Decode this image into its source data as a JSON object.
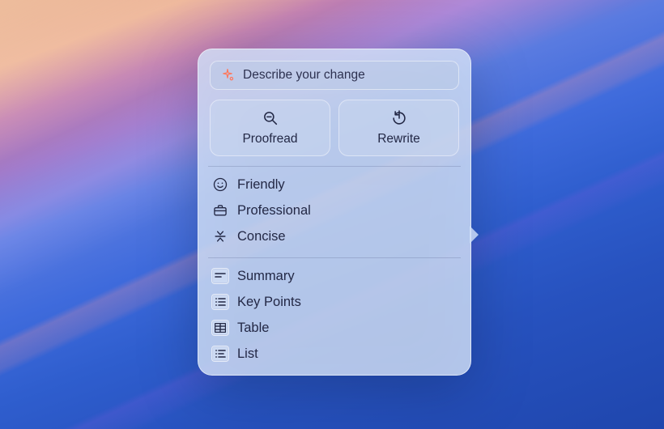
{
  "describe": {
    "placeholder": "Describe your change"
  },
  "actions": {
    "proofread": "Proofread",
    "rewrite": "Rewrite"
  },
  "tones": [
    {
      "label": "Friendly"
    },
    {
      "label": "Professional"
    },
    {
      "label": "Concise"
    }
  ],
  "formats": [
    {
      "label": "Summary"
    },
    {
      "label": "Key Points"
    },
    {
      "label": "Table"
    },
    {
      "label": "List"
    }
  ]
}
